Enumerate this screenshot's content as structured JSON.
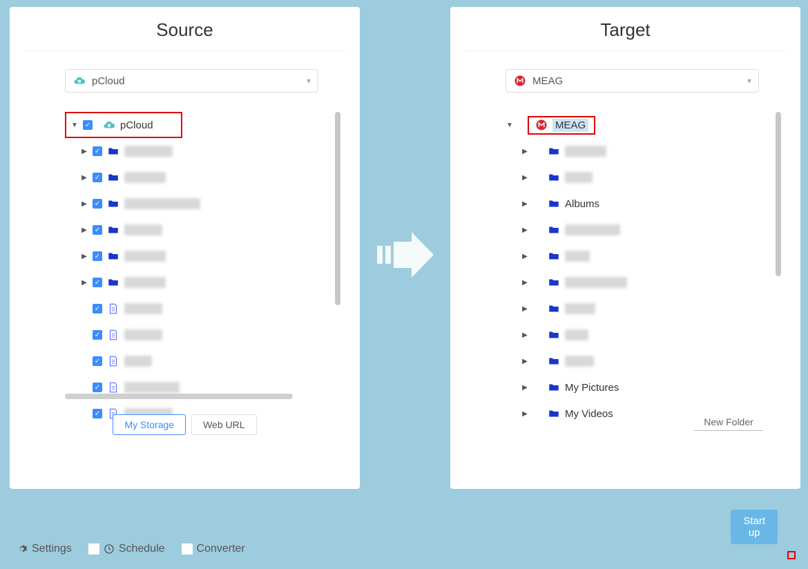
{
  "source": {
    "title": "Source",
    "dropdown_label": "pCloud",
    "root_label": "pCloud",
    "tabs": {
      "my_storage": "My Storage",
      "web_url": "Web URL"
    },
    "children_count": 11
  },
  "target": {
    "title": "Target",
    "dropdown_label": "MEAG",
    "root_label": "MEAG",
    "new_folder_label": "New Folder",
    "items": [
      {
        "label": "",
        "blur_w": 60
      },
      {
        "label": "",
        "blur_w": 40
      },
      {
        "label": "Albums"
      },
      {
        "label": "",
        "blur_w": 80
      },
      {
        "label": "",
        "blur_w": 36
      },
      {
        "label": "",
        "blur_w": 90
      },
      {
        "label": "",
        "blur_w": 44
      },
      {
        "label": "",
        "blur_w": 34
      },
      {
        "label": "",
        "blur_w": 42
      },
      {
        "label": "My Pictures"
      },
      {
        "label": "My Videos"
      }
    ]
  },
  "bottom": {
    "settings": "Settings",
    "schedule": "Schedule",
    "converter": "Converter",
    "start": "Start up"
  },
  "source_rows": [
    {
      "type": "folder",
      "blur_w": 70
    },
    {
      "type": "folder",
      "blur_w": 60
    },
    {
      "type": "folder",
      "blur_w": 110
    },
    {
      "type": "folder",
      "blur_w": 55
    },
    {
      "type": "folder",
      "blur_w": 60
    },
    {
      "type": "folder",
      "blur_w": 60
    },
    {
      "type": "file",
      "blur_w": 55
    },
    {
      "type": "file",
      "blur_w": 55
    },
    {
      "type": "file",
      "blur_w": 40
    },
    {
      "type": "file",
      "blur_w": 80
    },
    {
      "type": "file",
      "blur_w": 70
    }
  ]
}
